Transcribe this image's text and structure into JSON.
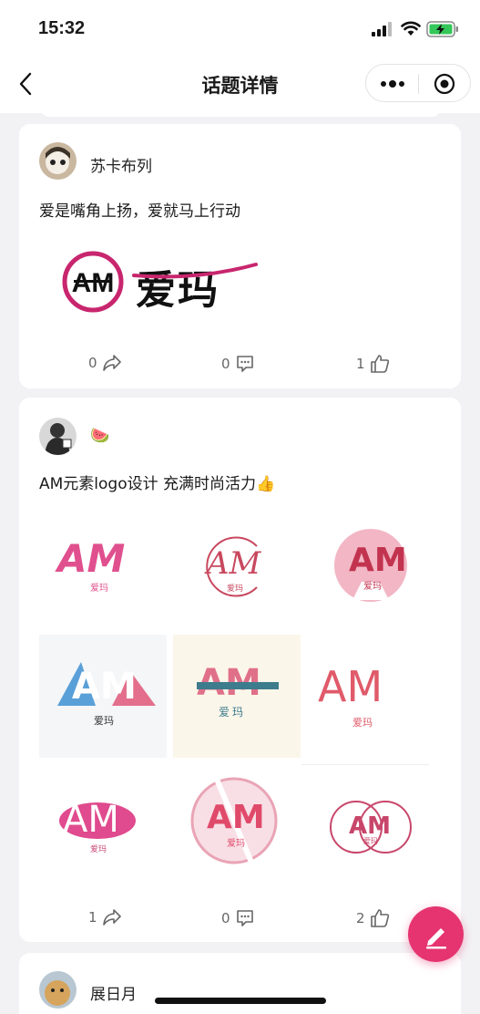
{
  "status": {
    "time": "15:32"
  },
  "nav": {
    "title": "话题详情"
  },
  "posts": [
    {
      "user": "苏卡布列",
      "text": "爱是嘴角上扬，爱就马上行动",
      "logo_text": "爱玛",
      "logo_mark": "AM",
      "shares": "0",
      "comments": "0",
      "likes": "1"
    },
    {
      "user": "🍉",
      "text": "AM元素logo设计 充满时尚活力👍",
      "logo_mark": "AM",
      "logo_sub": "爱玛",
      "shares": "1",
      "comments": "0",
      "likes": "2"
    },
    {
      "user": "展日月"
    }
  ],
  "colors": {
    "accent": "#e53470",
    "pink": "#e8508a"
  }
}
